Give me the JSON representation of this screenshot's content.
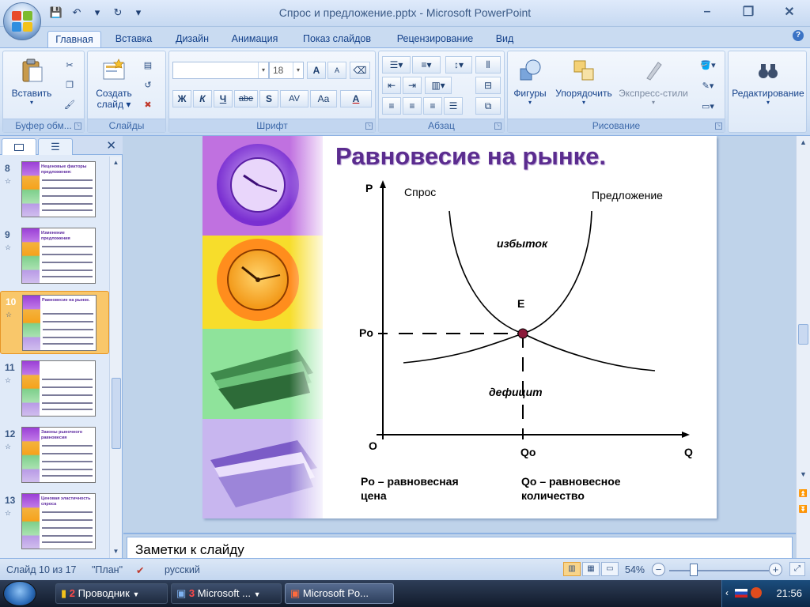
{
  "window": {
    "title": "Спрос и предложение.pptx - Microsoft PowerPoint",
    "controls": [
      "–",
      "❐",
      "✕"
    ]
  },
  "qat": [
    "💾",
    "↶",
    "▾",
    "↻",
    "▾"
  ],
  "tabs": [
    "Главная",
    "Вставка",
    "Дизайн",
    "Анимация",
    "Показ слайдов",
    "Рецензирование",
    "Вид"
  ],
  "ribbon": {
    "clipboard": {
      "paste": "Вставить",
      "label": "Буфер обм..."
    },
    "slides": {
      "new_slide_1": "Создать",
      "new_slide_2": "слайд",
      "label": "Слайды"
    },
    "font": {
      "font_size": "18",
      "label": "Шрифт",
      "bold": "Ж",
      "italic": "К",
      "underline": "Ч",
      "strike": "abe",
      "shadow": "S",
      "spacing": "AV",
      "case": "Aa",
      "color": "A",
      "grow": "A",
      "shrink": "A"
    },
    "paragraph": {
      "label": "Абзац"
    },
    "drawing": {
      "shapes": "Фигуры",
      "arrange": "Упорядочить",
      "styles": "Экспресс-стили",
      "label": "Рисование"
    },
    "editing": {
      "label": "Редактирование"
    }
  },
  "pane": {
    "close": "✕",
    "slides": [
      {
        "num": "8",
        "title": "Неценовые факторы предложения:"
      },
      {
        "num": "9",
        "title": "Изменение предложения"
      },
      {
        "num": "10",
        "title": "Равновесие на рынке."
      },
      {
        "num": "11",
        "title": ""
      },
      {
        "num": "12",
        "title": "Законы рыночного равновесия"
      },
      {
        "num": "13",
        "title": "Ценовая эластичность спроса"
      }
    ]
  },
  "slide": {
    "title": "Равновесие на рынке.",
    "axis_p": "P",
    "axis_q": "Q",
    "origin": "O",
    "demand": "Спрос",
    "supply": "Предложение",
    "surplus": "избыток",
    "shortage": "дефицит",
    "eq_point": "E",
    "p0": "Pо",
    "q0": "Qо",
    "p0_desc_1": "Pо – равновесная",
    "p0_desc_2": "цена",
    "q0_desc_1": "Qо – равновесное",
    "q0_desc_2": "количество"
  },
  "notes": {
    "text": "Заметки к слайду"
  },
  "status": {
    "slide_counter": "Слайд 10 из 17",
    "theme": "\"План\"",
    "language": "русский",
    "zoom": "54%",
    "zoom_fraction": 0.54
  },
  "taskbar": {
    "tasks": [
      {
        "count": "2",
        "label": "Проводник"
      },
      {
        "count": "3",
        "label": "Microsoft ..."
      },
      {
        "count": "",
        "label": "Microsoft Po..."
      }
    ],
    "clock": "21:56"
  }
}
